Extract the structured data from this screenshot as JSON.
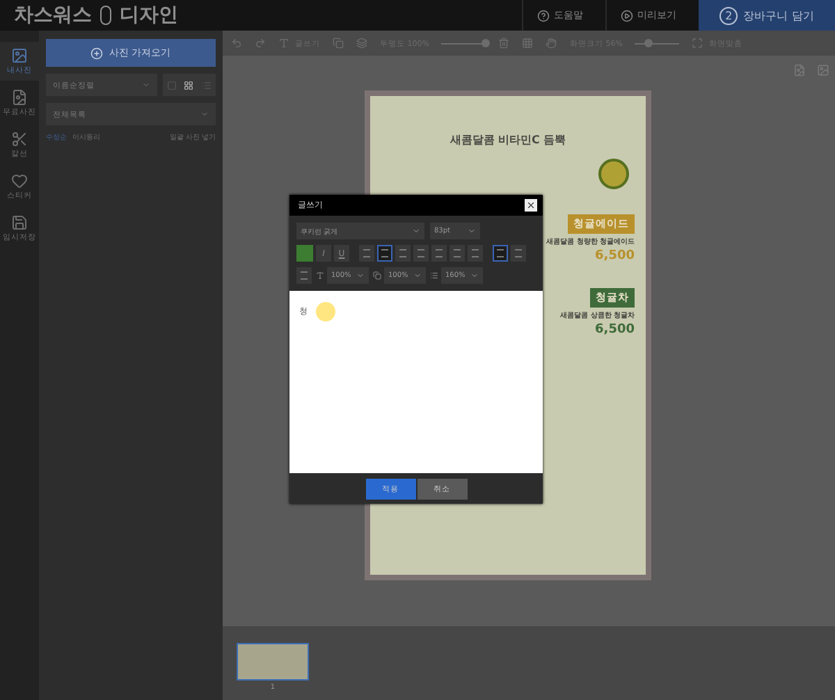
{
  "header": {
    "brand": [
      "차스워스",
      "디자인"
    ],
    "links": [
      {
        "label": "도움말"
      },
      {
        "label": "미리보기"
      }
    ],
    "cart": {
      "step": "2",
      "label": "장바구니 담기"
    }
  },
  "rail": {
    "items": [
      {
        "label": "내사진",
        "selected": true
      },
      {
        "label": "무료사진",
        "selected": false
      },
      {
        "label": "칼선",
        "selected": false
      },
      {
        "label": "스티커",
        "selected": false
      },
      {
        "label": "임시저장",
        "selected": false
      }
    ]
  },
  "panel": {
    "import_button": "사진 가져오기",
    "sort": "이름순정렬",
    "view_modes": [
      {
        "selected": false
      },
      {
        "selected": true
      },
      {
        "selected": false
      }
    ],
    "filter": "전체목록",
    "links": [
      "수정순",
      "이시등리"
    ],
    "bulk_link": "일괄 사진 넣기"
  },
  "toolbar": {
    "write": "글쓰기",
    "opacity_label": "투명도",
    "opacity_value": "100%",
    "opacity": {
      "level": 1
    },
    "zoom_label": "화면크기",
    "zoom_value": "56%",
    "zoom": {
      "level": 0.3
    },
    "fit": "화면맞춤"
  },
  "poster": {
    "headline": "새콤달콤 비타민C 듬뿍",
    "items": [
      {
        "name": "청귤에이드",
        "desc": "새콤달콤 청량한 청귤에이드",
        "price": "6,500",
        "color": "#b8912c"
      },
      {
        "name": "청귤차",
        "desc": "새콤달콤 상큼한 청귤차",
        "price": "6,500",
        "color": "#3f6b3a"
      }
    ]
  },
  "dialog": {
    "title": "글쓰기",
    "font": "쿠키런 굵게",
    "size": "83pt",
    "color": "#3c7d32",
    "styles": [
      "I",
      "U"
    ],
    "align": [
      {
        "selected": false
      },
      {
        "selected": true
      },
      {
        "selected": false
      },
      {
        "selected": false
      },
      {
        "selected": false
      },
      {
        "selected": false
      },
      {
        "selected": false
      }
    ],
    "direction": [
      {
        "selected": true
      },
      {
        "selected": false
      }
    ],
    "spacing": [
      {
        "kind": "height",
        "value": "100%"
      },
      {
        "kind": "letter",
        "value": "100%"
      },
      {
        "kind": "line",
        "value": "160%"
      }
    ],
    "text": "청",
    "apply": "적용",
    "cancel": "취소"
  },
  "filmstrip": {
    "pages": [
      {
        "number": "1",
        "selected": true
      }
    ]
  }
}
